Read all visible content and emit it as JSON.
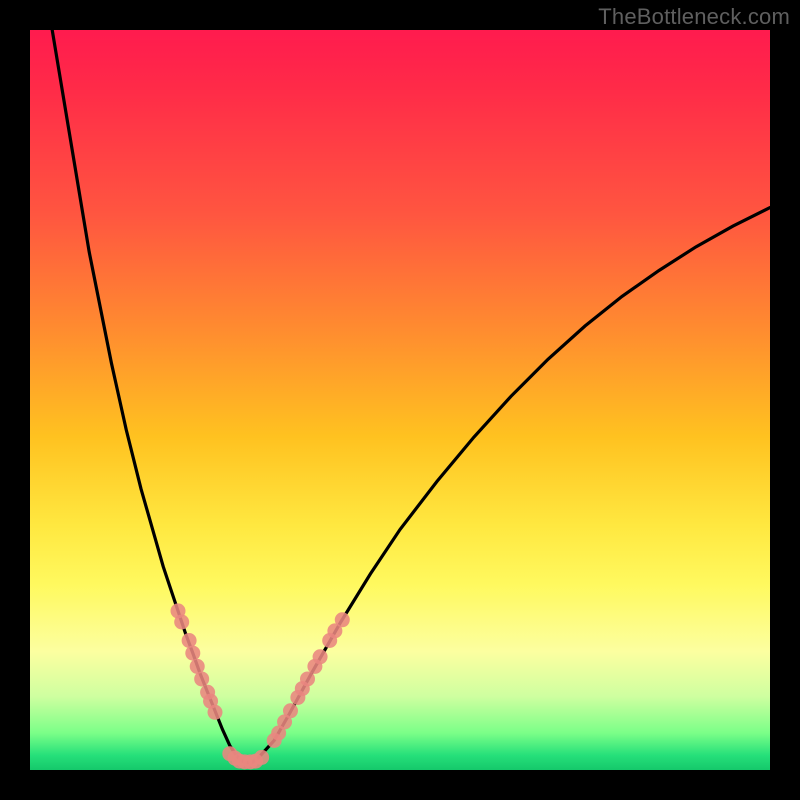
{
  "watermark": "TheBottleneck.com",
  "colors": {
    "frame": "#000000",
    "curve": "#000000",
    "marker": "#e98680",
    "gradient_top": "#ff1b4e",
    "gradient_bottom": "#15c86b"
  },
  "chart_data": {
    "type": "line",
    "title": "",
    "xlabel": "",
    "ylabel": "",
    "xlim": [
      0,
      100
    ],
    "ylim": [
      0,
      100
    ],
    "series": [
      {
        "name": "bottleneck-curve",
        "x": [
          3,
          4,
          5,
          6,
          7,
          8,
          9,
          10,
          11,
          12,
          13,
          14,
          15,
          16,
          17,
          18,
          19,
          20,
          21,
          22,
          23,
          24,
          25,
          26,
          27,
          28,
          29,
          30,
          31,
          33,
          35,
          38,
          42,
          46,
          50,
          55,
          60,
          65,
          70,
          75,
          80,
          85,
          90,
          95,
          100
        ],
        "y": [
          100,
          94,
          88,
          82,
          76,
          70,
          65,
          60,
          55,
          50.5,
          46,
          42,
          38,
          34.5,
          31,
          27.5,
          24.5,
          21.5,
          18.5,
          15.8,
          13,
          10.5,
          8,
          5.5,
          3.3,
          1.8,
          1.0,
          1.0,
          1.8,
          4.0,
          7.5,
          13,
          20,
          26.5,
          32.5,
          39,
          45,
          50.5,
          55.5,
          60,
          64,
          67.5,
          70.7,
          73.5,
          76
        ]
      }
    ],
    "markers": {
      "name": "highlighted-points",
      "points": [
        {
          "x": 20.0,
          "y": 21.5
        },
        {
          "x": 20.5,
          "y": 20.0
        },
        {
          "x": 21.5,
          "y": 17.5
        },
        {
          "x": 22.0,
          "y": 15.8
        },
        {
          "x": 22.6,
          "y": 14.0
        },
        {
          "x": 23.2,
          "y": 12.3
        },
        {
          "x": 24.0,
          "y": 10.5
        },
        {
          "x": 24.4,
          "y": 9.3
        },
        {
          "x": 25.0,
          "y": 7.8
        },
        {
          "x": 27.0,
          "y": 2.2
        },
        {
          "x": 27.7,
          "y": 1.6
        },
        {
          "x": 28.3,
          "y": 1.2
        },
        {
          "x": 29.0,
          "y": 1.1
        },
        {
          "x": 29.8,
          "y": 1.1
        },
        {
          "x": 30.5,
          "y": 1.2
        },
        {
          "x": 31.3,
          "y": 1.7
        },
        {
          "x": 33.0,
          "y": 4.0
        },
        {
          "x": 33.6,
          "y": 5.0
        },
        {
          "x": 34.4,
          "y": 6.5
        },
        {
          "x": 35.2,
          "y": 8.0
        },
        {
          "x": 36.2,
          "y": 9.8
        },
        {
          "x": 36.8,
          "y": 11.0
        },
        {
          "x": 37.5,
          "y": 12.3
        },
        {
          "x": 38.5,
          "y": 14.0
        },
        {
          "x": 39.2,
          "y": 15.3
        },
        {
          "x": 40.5,
          "y": 17.5
        },
        {
          "x": 41.2,
          "y": 18.8
        },
        {
          "x": 42.2,
          "y": 20.3
        }
      ]
    }
  }
}
